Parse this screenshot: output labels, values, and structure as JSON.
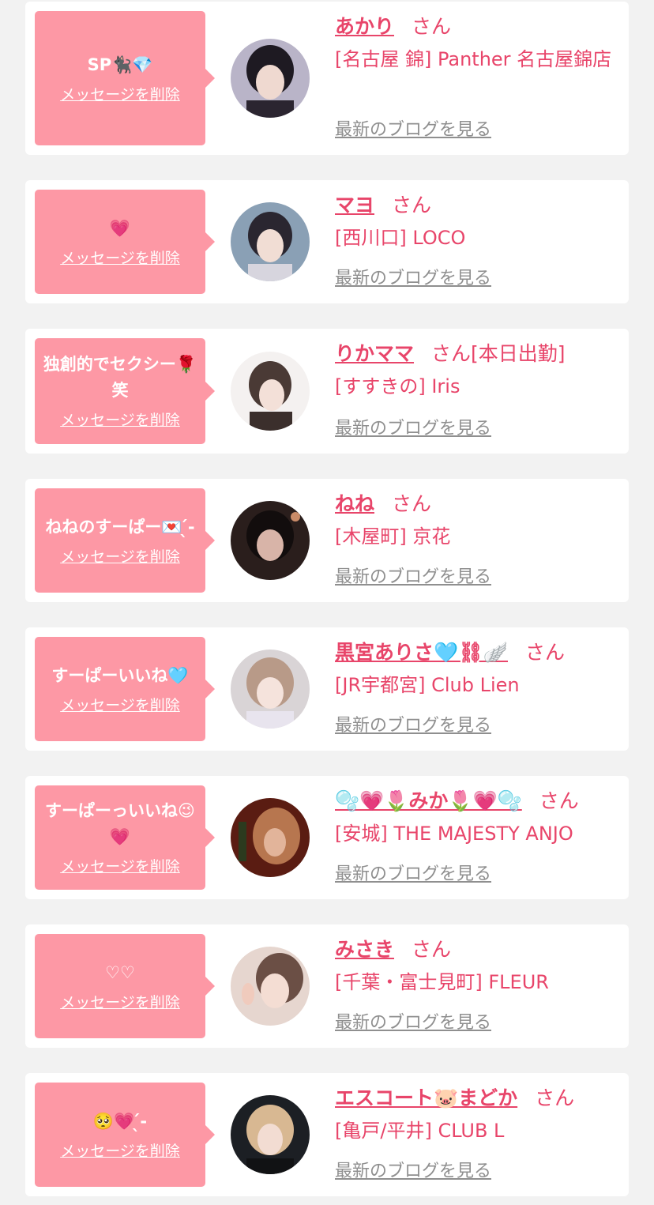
{
  "delete_label": "メッセージを削除",
  "blog_label": "最新のブログを見る",
  "san_label": "さん",
  "colors": {
    "bubble": "#fd98a5",
    "accent": "#e8456a",
    "link_gray": "#8f8f8f",
    "background": "#f2f2f2"
  },
  "cards": [
    {
      "message": "SP🐈‍⬛💎",
      "name": "あかり",
      "status": "",
      "shop": "[名古屋 錦] Panther 名古屋錦店"
    },
    {
      "message": "💗",
      "name": "マヨ",
      "status": "",
      "shop": "[西川口] LOCO"
    },
    {
      "message": "独創的でセクシー🌹笑",
      "name": "りかママ",
      "status": "[本日出勤]",
      "shop": "[すすきの] Iris"
    },
    {
      "message": "ねねのすーぱー💌 ̖́-",
      "name": "ねね",
      "status": "",
      "shop": "[木屋町] 京花"
    },
    {
      "message": "すーぱーいいね🩵",
      "name": "黒宮ありさ🩵⛓🪽",
      "status": "",
      "shop": "[JR宇都宮] Club Lien"
    },
    {
      "message": "すーぱーっいいね😉💗",
      "name": "🫧💗🌷みか🌷💗🫧",
      "status": "",
      "shop": "[安城] THE MAJESTY ANJO"
    },
    {
      "message": "♡♡",
      "name": "みさき",
      "status": "",
      "shop": "[千葉・富士見町] FLEUR"
    },
    {
      "message": "🥺💗 ̖́-",
      "name": "エスコート🐷まどか",
      "status": "",
      "shop": "[亀戸/平井] CLUB L"
    }
  ]
}
